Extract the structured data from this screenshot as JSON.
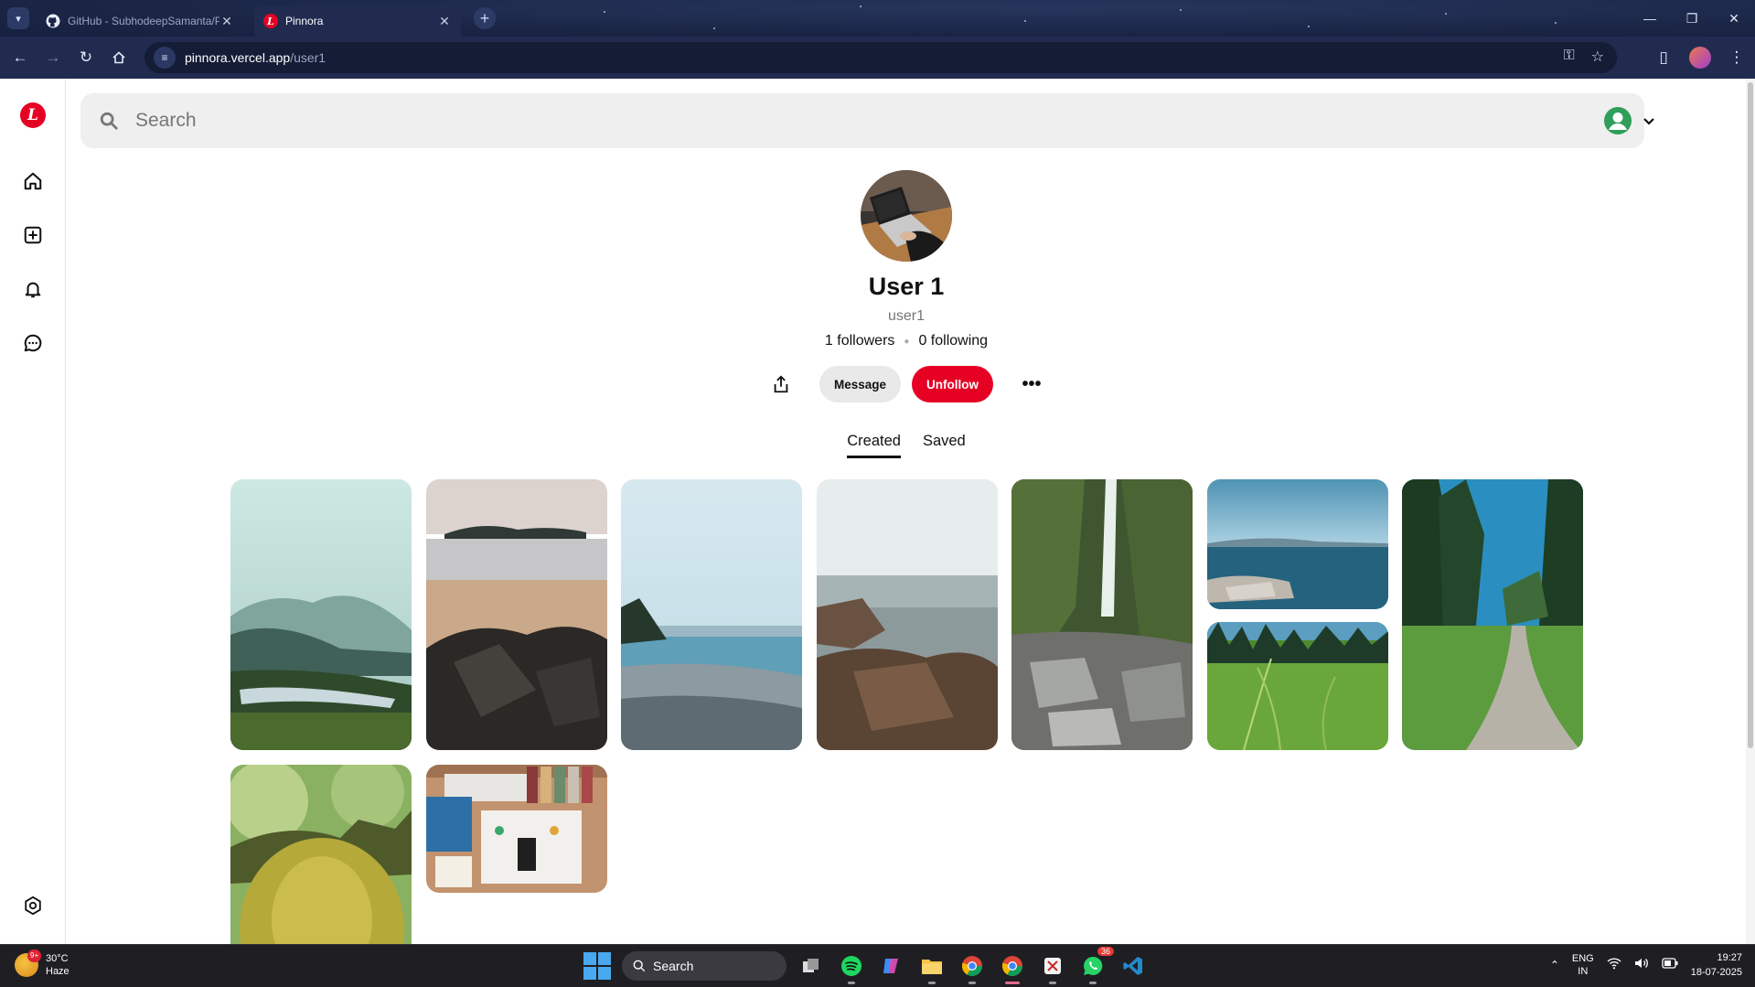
{
  "browser": {
    "tabs": [
      {
        "title": "GitHub - SubhodeepSamanta/Pinnora",
        "active": false,
        "favicon": "github-icon"
      },
      {
        "title": "Pinnora",
        "active": true,
        "favicon": "pinnora-logo-icon"
      }
    ],
    "url_host": "pinnora.vercel.app",
    "url_path": "/user1"
  },
  "app": {
    "logo_letter": "L",
    "brand_color": "#e60023",
    "search_placeholder": "Search",
    "sidebar_icons": [
      "home-icon",
      "create-icon",
      "notifications-icon",
      "messages-icon",
      "settings-icon"
    ]
  },
  "profile": {
    "display_name": "User 1",
    "username": "user1",
    "followers": "1 followers",
    "following": "0 following",
    "message_label": "Message",
    "unfollow_label": "Unfollow",
    "more_label": "•••",
    "tabs": [
      {
        "label": "Created",
        "active": true
      },
      {
        "label": "Saved",
        "active": false
      }
    ]
  },
  "pins": [
    {
      "scene": "misty-valley"
    },
    {
      "scene": "beach-rocks"
    },
    {
      "scene": "pebble-shore"
    },
    {
      "scene": "coastal-rocks"
    },
    {
      "scene": "waterfall-gorge"
    },
    {
      "scene": "sea-horizon"
    },
    {
      "scene": "forest-path"
    },
    {
      "scene": "grass-closeup"
    },
    {
      "scene": "mossy-tree"
    },
    {
      "scene": "desk-flatlay"
    }
  ],
  "taskbar": {
    "weather_temp": "30°C",
    "weather_desc": "Haze",
    "weather_badge": "9+",
    "search_label": "Search",
    "whatsapp_badge": "36",
    "lang_line1": "ENG",
    "lang_line2": "IN",
    "time": "19:27",
    "date": "18-07-2025"
  }
}
